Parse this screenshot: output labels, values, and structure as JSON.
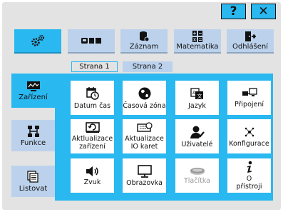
{
  "header": {
    "help_label": "?",
    "close_label": "✕"
  },
  "toolbar": {
    "settings_icon": "gears-icon",
    "status_icon": "devices-icon",
    "record_label": "Záznam",
    "math_label": "Matematika",
    "logout_label": "Odhlášení"
  },
  "tabs": {
    "page1": "Strana 1",
    "page2": "Strana 2"
  },
  "sidebar": {
    "devices_label": "Zařízení",
    "functions_label": "Funkce",
    "list_label": "Listovat"
  },
  "tiles": {
    "datetime": "Datum čas",
    "timezone": "Časová zóna",
    "language": "Jazyk",
    "connection": "Připojení",
    "update_device": "Aktlualizace zařízení",
    "update_io": "Aktualizace IO karet",
    "users": "Uživatelé",
    "configuration": "Konfigurace",
    "sound": "Zvuk",
    "display": "Obrazovka",
    "buttons": "Tlačítka",
    "about": "O přístroji"
  },
  "colors": {
    "accent": "#29b8f0",
    "button_bg": "#bcd2ec",
    "screen_bg": "#e3e3e3"
  }
}
